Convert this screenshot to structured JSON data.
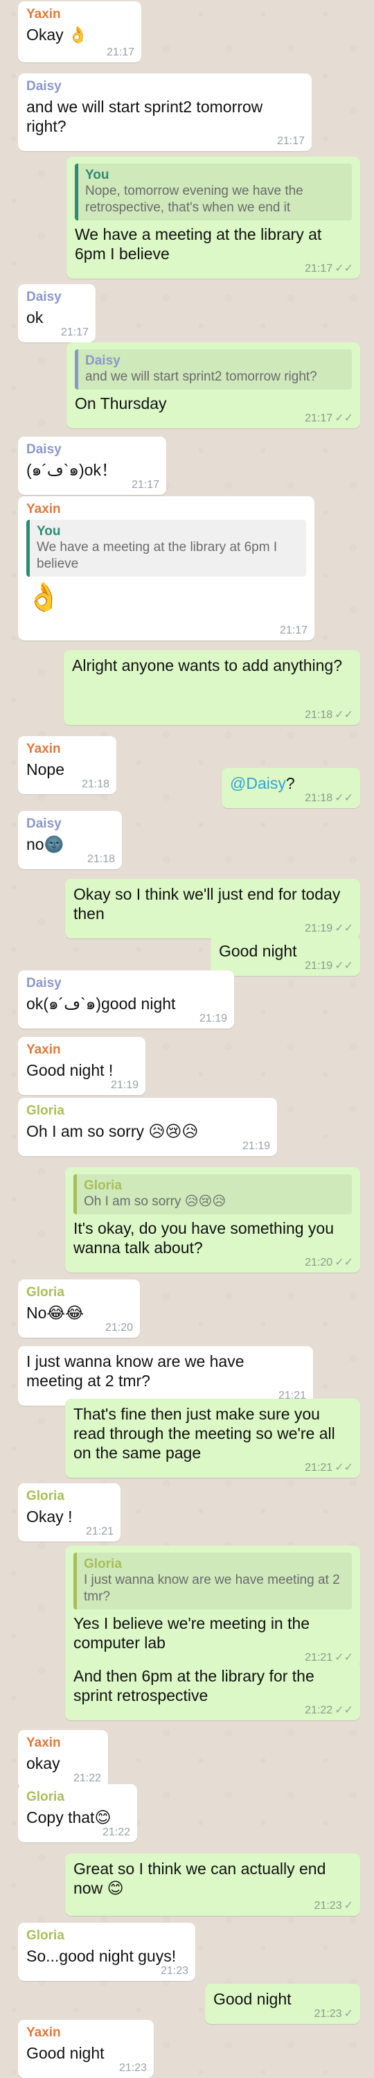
{
  "colors": {
    "Yaxin": "#e0783b",
    "Daisy": "#8b97c8",
    "Gloria": "#a9be57",
    "You": "#2e8c74",
    "incoming_bg": "#ffffff",
    "outgoing_bg": "#dcf8c6",
    "wallpaper": "#e5ddd3"
  },
  "messages": [
    {
      "dir": "in",
      "sender": "Yaxin",
      "text": "Okay 👌",
      "time": "21:17"
    },
    {
      "dir": "in",
      "sender": "Daisy",
      "text": "and we will start sprint2 tomorrow right?",
      "time": "21:17"
    },
    {
      "dir": "out",
      "quote": {
        "sender": "You",
        "text": "Nope, tomorrow evening we have the retrospective, that's when we end it"
      },
      "text": "We have a meeting at the library at 6pm I believe",
      "time": "21:17",
      "ticks": "✓✓"
    },
    {
      "dir": "in",
      "sender": "Daisy",
      "text": "ok",
      "time": "21:17"
    },
    {
      "dir": "out",
      "quote": {
        "sender": "Daisy",
        "text": "and we will start sprint2 tomorrow right?"
      },
      "text": "On Thursday",
      "time": "21:17",
      "ticks": "✓✓"
    },
    {
      "dir": "in",
      "sender": "Daisy",
      "text": "(๑´ڡ`๑)ok！",
      "time": "21:17"
    },
    {
      "dir": "in",
      "sender": "Yaxin",
      "quote": {
        "sender": "You",
        "text": "We have a meeting at the library at 6pm I believe"
      },
      "text": "👌",
      "time": "21:17"
    },
    {
      "dir": "out",
      "text": "Alright anyone wants to add anything?",
      "time": "21:18",
      "ticks": "✓✓"
    },
    {
      "dir": "in",
      "sender": "Yaxin",
      "text": "Nope",
      "time": "21:18"
    },
    {
      "dir": "out",
      "mention": "@Daisy",
      "text": "?",
      "time": "21:18",
      "ticks": "✓✓"
    },
    {
      "dir": "in",
      "sender": "Daisy",
      "text": "no🌚",
      "time": "21:18"
    },
    {
      "dir": "out",
      "text": "Okay so I think we'll just end for today then",
      "time": "21:19",
      "ticks": "✓✓"
    },
    {
      "dir": "out",
      "text": "Good night",
      "time": "21:19",
      "ticks": "✓✓"
    },
    {
      "dir": "in",
      "sender": "Daisy",
      "text": "ok(๑´ڡ`๑)good night",
      "time": "21:19"
    },
    {
      "dir": "in",
      "sender": "Yaxin",
      "text": "Good night !",
      "time": "21:19"
    },
    {
      "dir": "in",
      "sender": "Gloria",
      "text": "Oh I am so sorry 😥😢😥",
      "time": "21:19"
    },
    {
      "dir": "out",
      "quote": {
        "sender": "Gloria",
        "text": "Oh I am so sorry 😥😢😥"
      },
      "text": "It's okay, do you have something you wanna talk about?",
      "time": "21:20",
      "ticks": "✓✓"
    },
    {
      "dir": "in",
      "sender": "Gloria",
      "text": "No😂😂",
      "time": "21:20"
    },
    {
      "dir": "in",
      "text": "I just wanna know are we have meeting at 2 tmr?",
      "time": "21:21"
    },
    {
      "dir": "out",
      "text": "That's fine then just make sure you read through the meeting so we're all on the same page",
      "time": "21:21",
      "ticks": "✓✓"
    },
    {
      "dir": "in",
      "sender": "Gloria",
      "text": "Okay !",
      "time": "21:21"
    },
    {
      "dir": "out",
      "quote": {
        "sender": "Gloria",
        "text": "I just wanna know are we have meeting at 2 tmr?"
      },
      "text": "Yes I believe we're meeting in the computer lab",
      "time": "21:21",
      "ticks": "✓✓"
    },
    {
      "dir": "out",
      "text": "And then 6pm at the library for the sprint retrospective",
      "time": "21:22",
      "ticks": "✓✓"
    },
    {
      "dir": "in",
      "sender": "Yaxin",
      "text": "okay",
      "time": "21:22"
    },
    {
      "dir": "in",
      "sender": "Gloria",
      "text": "Copy that😊",
      "time": "21:22"
    },
    {
      "dir": "out",
      "text": "Great so I think we can actually end now 😊",
      "time": "21:23",
      "ticks": "✓"
    },
    {
      "dir": "in",
      "sender": "Gloria",
      "text": "So...good night guys!",
      "time": "21:23"
    },
    {
      "dir": "out",
      "text": "Good night",
      "time": "21:23",
      "ticks": "✓"
    },
    {
      "dir": "in",
      "sender": "Yaxin",
      "text": "Good night",
      "time": "21:23"
    }
  ]
}
